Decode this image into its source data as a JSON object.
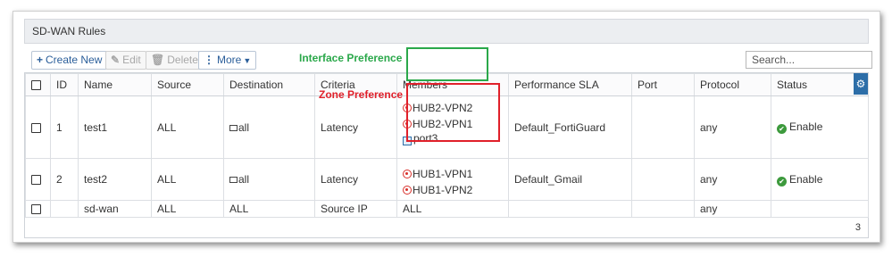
{
  "panel": {
    "title": "SD-WAN Rules"
  },
  "toolbar": {
    "create_new": "Create New",
    "edit": "Edit",
    "delete": "Delete",
    "more": "More"
  },
  "search": {
    "placeholder": "Search..."
  },
  "columns": [
    "ID",
    "Name",
    "Source",
    "Destination",
    "Criteria",
    "Members",
    "Performance SLA",
    "Port",
    "Protocol",
    "Status"
  ],
  "rows": [
    {
      "id": "1",
      "name": "test1",
      "source": "ALL",
      "destination": "all",
      "criteria": "Latency",
      "members": [
        "HUB2-VPN2",
        "HUB2-VPN1",
        "port3"
      ],
      "sla": "Default_FortiGuard",
      "port": "",
      "protocol": "any",
      "status": "Enable"
    },
    {
      "id": "2",
      "name": "test2",
      "source": "ALL",
      "destination": "all",
      "criteria": "Latency",
      "members": [
        "HUB1-VPN1",
        "HUB1-VPN2"
      ],
      "sla": "Default_Gmail",
      "port": "",
      "protocol": "any",
      "status": "Enable"
    },
    {
      "id": "",
      "name": "sd-wan",
      "source": "ALL",
      "destination": "ALL",
      "criteria": "Source IP",
      "members": [
        "ALL"
      ],
      "sla": "",
      "port": "",
      "protocol": "any",
      "status": ""
    }
  ],
  "annotations": {
    "interface": "Interface Preference",
    "zone": "Zone Preference"
  },
  "footer": {
    "count": "3"
  },
  "colors": {
    "accent": "#2d6ea8",
    "annotation_green": "#2aa84a",
    "annotation_red": "#e0202a",
    "enable_green": "#3d9a3d"
  }
}
